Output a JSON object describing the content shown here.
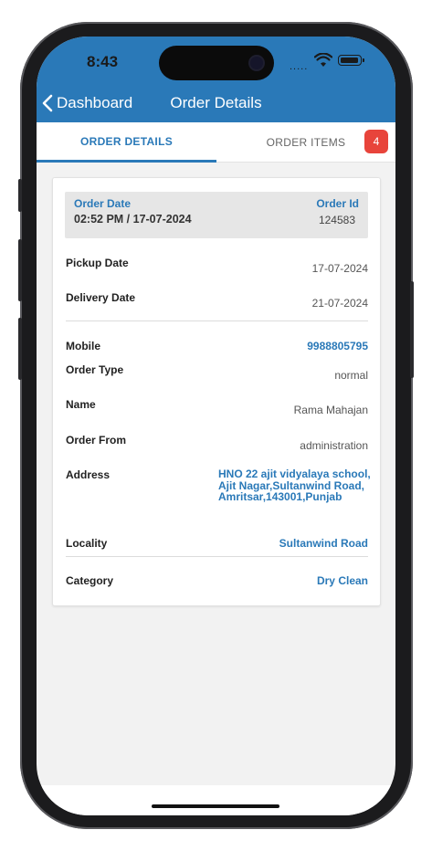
{
  "status_bar": {
    "time": "8:43",
    "signal": "....."
  },
  "nav": {
    "back_label": "Dashboard",
    "title": "Order Details"
  },
  "tabs": [
    {
      "label": "ORDER DETAILS",
      "active": true
    },
    {
      "label": "ORDER ITEMS",
      "active": false
    }
  ],
  "badge_count": "4",
  "order": {
    "order_date_label": "Order Date",
    "order_date_value": "02:52 PM / 17-07-2024",
    "order_id_label": "Order Id",
    "order_id_value": "124583"
  },
  "fields": {
    "pickup_date_label": "Pickup Date",
    "pickup_date_value": "17-07-2024",
    "delivery_date_label": "Delivery Date",
    "delivery_date_value": "21-07-2024",
    "mobile_label": "Mobile",
    "mobile_value": "9988805795",
    "order_type_label": "Order Type",
    "order_type_value": "normal",
    "name_label": "Name",
    "name_value": "Rama Mahajan",
    "order_from_label": "Order From",
    "order_from_value": "administration",
    "address_label": "Address",
    "address_value": "HNO 22 ajit vidyalaya school,Ajit Nagar,Sultanwind Road,Amritsar,143001,Punjab",
    "locality_label": "Locality",
    "locality_value": "Sultanwind Road",
    "category_label": "Category",
    "category_value": "Dry Clean"
  },
  "colors": {
    "accent": "#2a79b8",
    "badge": "#e8443b",
    "background": "#f2f2f2"
  }
}
